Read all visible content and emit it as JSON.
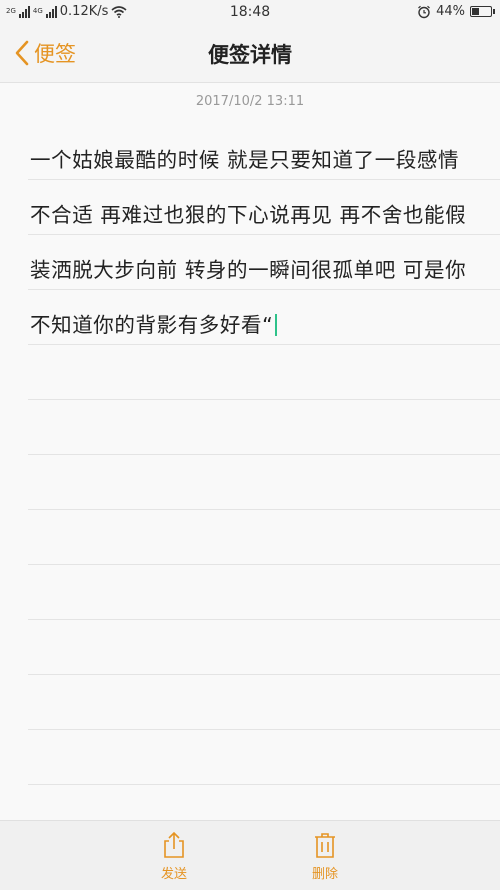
{
  "status_bar": {
    "signal1_label": "2G",
    "signal2_label": "4G",
    "network_speed": "0.12K/s",
    "time": "18:48",
    "battery": "44%",
    "battery_level": 0.44
  },
  "header": {
    "back_label": "便签",
    "title": "便签详情"
  },
  "note": {
    "timestamp": "2017/10/2 13:11",
    "text": "一个姑娘最酷的时候 就是只要知道了一段感情不合适 再难过也狠的下心说再见 再不舍也能假装洒脱大步向前 转身的一瞬间很孤单吧 可是你不知道你的背影有多好看“"
  },
  "toolbar": {
    "send_label": "发送",
    "delete_label": "删除"
  },
  "colors": {
    "accent": "#e59423",
    "caret": "#2ec28a"
  },
  "icons": {
    "back": "chevron-left-icon",
    "send": "share-icon",
    "delete": "trash-icon",
    "alarm": "alarm-icon",
    "wifi": "wifi-icon"
  }
}
